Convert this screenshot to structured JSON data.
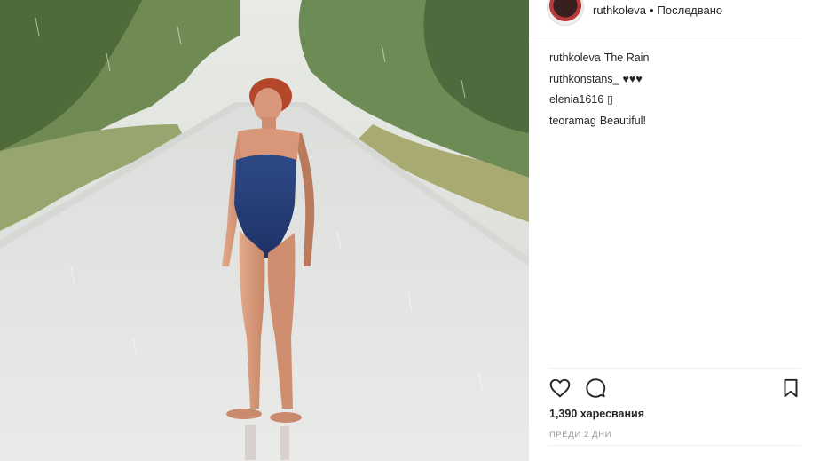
{
  "post": {
    "author": "ruthkoleva",
    "follow_status": "Последвано",
    "separator": "•"
  },
  "comments": [
    {
      "user": "ruthkoleva",
      "text": "The Rain"
    },
    {
      "user": "ruthkonstans_",
      "text": "♥♥♥"
    },
    {
      "user": "elenia1616",
      "text": "▯"
    },
    {
      "user": "teoramag",
      "text": "Beautiful!"
    }
  ],
  "actions": {
    "like_icon": "heart-icon",
    "comment_icon": "comment-icon",
    "save_icon": "bookmark-icon"
  },
  "likes": "1,390 харесвания",
  "time_ago": "ПРЕДИ 2 ДНИ",
  "colors": {
    "text": "#262626",
    "muted": "#999999",
    "divider": "#efefef"
  }
}
